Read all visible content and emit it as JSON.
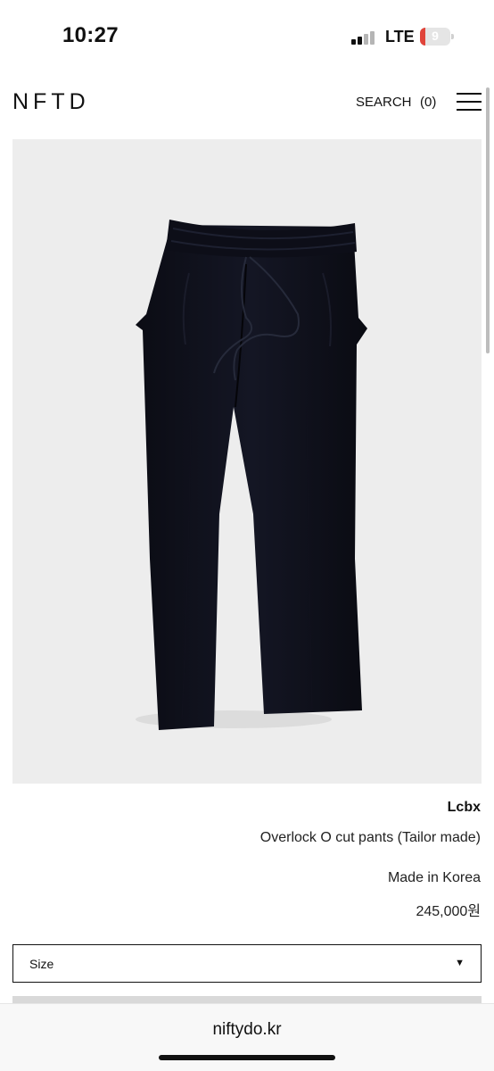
{
  "status_bar": {
    "time": "10:27",
    "network": "LTE",
    "battery_level": "9",
    "battery_color": "#e0443a",
    "signal_icon": "cellular-signal-icon",
    "battery_icon": "battery-charging-icon"
  },
  "header": {
    "logo": "NFTD",
    "search_label": "SEARCH",
    "cart_count": "(0)",
    "menu_icon": "hamburger-menu-icon"
  },
  "product": {
    "image_description_icon": "product-photo",
    "brand": "Lcbx",
    "name": "Overlock O cut pants (Tailor made)",
    "origin": "Made in Korea",
    "price": "245,000원"
  },
  "options": {
    "size_label": "Size",
    "dropdown_icon": "dropdown-arrow-icon"
  },
  "browser": {
    "url": "niftydo.kr"
  }
}
